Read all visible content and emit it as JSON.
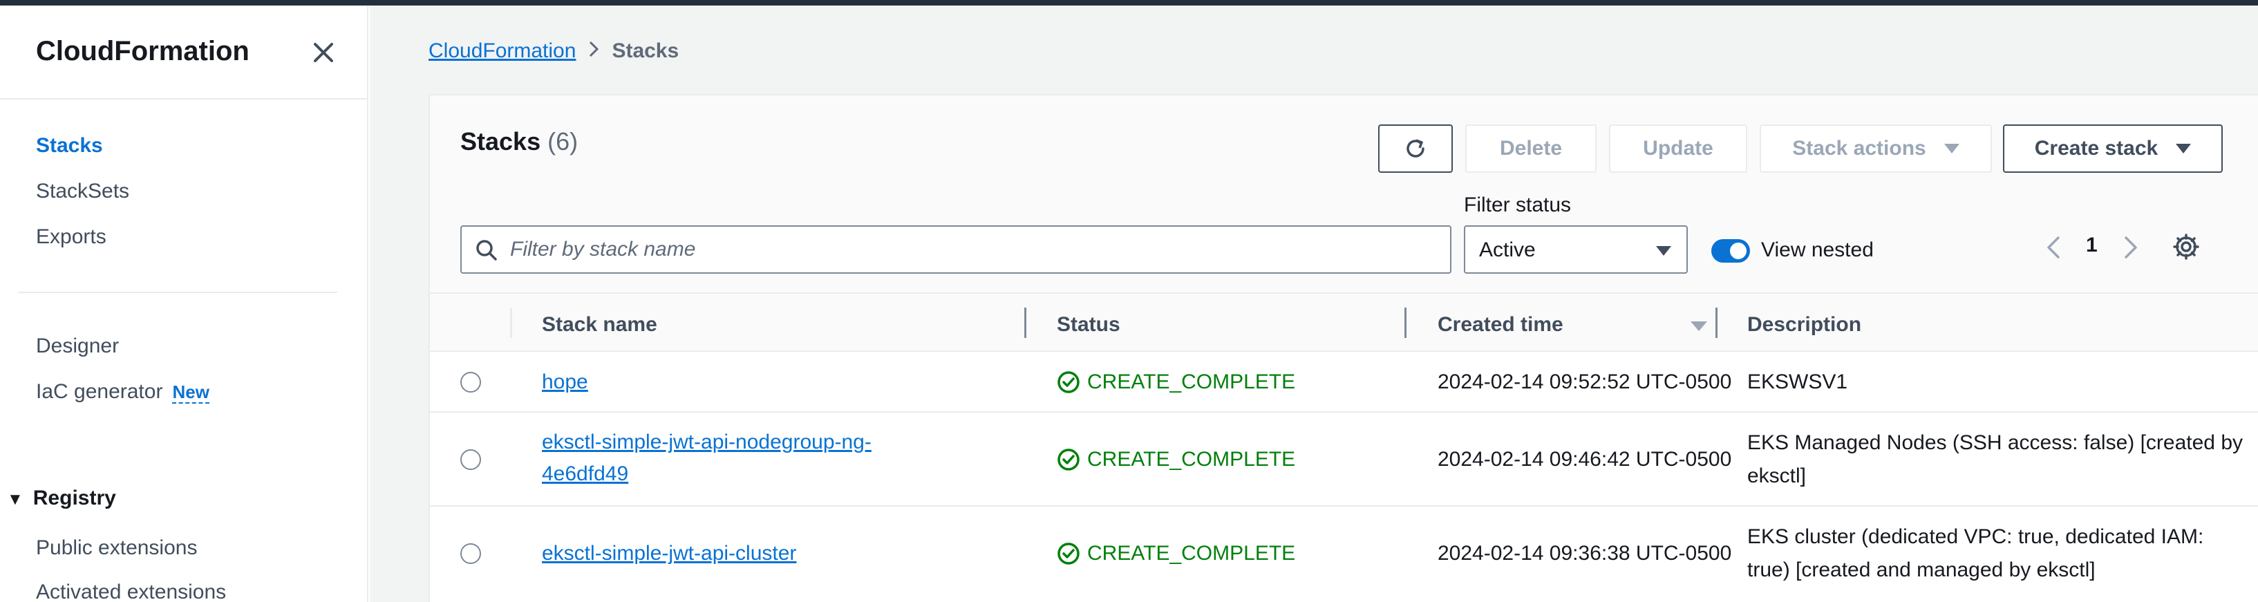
{
  "sidebar": {
    "title": "CloudFormation",
    "items": [
      {
        "label": "Stacks"
      },
      {
        "label": "StackSets"
      },
      {
        "label": "Exports"
      }
    ],
    "tools": [
      {
        "label": "Designer"
      },
      {
        "label": "IaC generator",
        "badge": "New"
      }
    ],
    "registry": {
      "label": "Registry",
      "items": [
        {
          "label": "Public extensions"
        },
        {
          "label": "Activated extensions"
        }
      ]
    }
  },
  "breadcrumb": {
    "root": "CloudFormation",
    "current": "Stacks"
  },
  "panel": {
    "title": "Stacks",
    "count": "(6)",
    "buttons": {
      "delete": "Delete",
      "update": "Update",
      "stack_actions": "Stack actions",
      "create_stack": "Create stack"
    },
    "search_placeholder": "Filter by stack name",
    "filter_label": "Filter status",
    "filter_value": "Active",
    "toggle_label": "View nested",
    "page": "1"
  },
  "table": {
    "columns": {
      "name": "Stack name",
      "status": "Status",
      "created": "Created time",
      "description": "Description"
    },
    "rows": [
      {
        "name": "hope",
        "status": "CREATE_COMPLETE",
        "created": "2024-02-14 09:52:52 UTC-0500",
        "description": "EKSWSV1"
      },
      {
        "name": "eksctl-simple-jwt-api-nodegroup-ng-4e6dfd49",
        "status": "CREATE_COMPLETE",
        "created": "2024-02-14 09:46:42 UTC-0500",
        "description": "EKS Managed Nodes (SSH access: false) [created by eksctl]"
      },
      {
        "name": "eksctl-simple-jwt-api-cluster",
        "status": "CREATE_COMPLETE",
        "created": "2024-02-14 09:36:38 UTC-0500",
        "description": "EKS cluster (dedicated VPC: true, dedicated IAM: true) [created and managed by eksctl]"
      }
    ]
  },
  "colors": {
    "link": "#0972d3",
    "success": "#037f0c",
    "topbar": "#232f3e"
  }
}
